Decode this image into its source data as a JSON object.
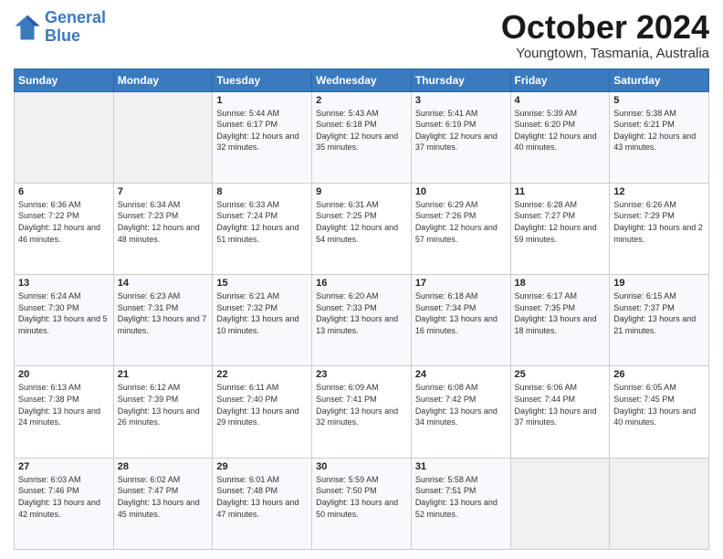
{
  "header": {
    "logo_line1": "General",
    "logo_line2": "Blue",
    "month": "October 2024",
    "location": "Youngtown, Tasmania, Australia"
  },
  "days_of_week": [
    "Sunday",
    "Monday",
    "Tuesday",
    "Wednesday",
    "Thursday",
    "Friday",
    "Saturday"
  ],
  "weeks": [
    [
      {
        "day": "",
        "info": ""
      },
      {
        "day": "",
        "info": ""
      },
      {
        "day": "1",
        "info": "Sunrise: 5:44 AM\nSunset: 6:17 PM\nDaylight: 12 hours and 32 minutes."
      },
      {
        "day": "2",
        "info": "Sunrise: 5:43 AM\nSunset: 6:18 PM\nDaylight: 12 hours and 35 minutes."
      },
      {
        "day": "3",
        "info": "Sunrise: 5:41 AM\nSunset: 6:19 PM\nDaylight: 12 hours and 37 minutes."
      },
      {
        "day": "4",
        "info": "Sunrise: 5:39 AM\nSunset: 6:20 PM\nDaylight: 12 hours and 40 minutes."
      },
      {
        "day": "5",
        "info": "Sunrise: 5:38 AM\nSunset: 6:21 PM\nDaylight: 12 hours and 43 minutes."
      }
    ],
    [
      {
        "day": "6",
        "info": "Sunrise: 6:36 AM\nSunset: 7:22 PM\nDaylight: 12 hours and 46 minutes."
      },
      {
        "day": "7",
        "info": "Sunrise: 6:34 AM\nSunset: 7:23 PM\nDaylight: 12 hours and 48 minutes."
      },
      {
        "day": "8",
        "info": "Sunrise: 6:33 AM\nSunset: 7:24 PM\nDaylight: 12 hours and 51 minutes."
      },
      {
        "day": "9",
        "info": "Sunrise: 6:31 AM\nSunset: 7:25 PM\nDaylight: 12 hours and 54 minutes."
      },
      {
        "day": "10",
        "info": "Sunrise: 6:29 AM\nSunset: 7:26 PM\nDaylight: 12 hours and 57 minutes."
      },
      {
        "day": "11",
        "info": "Sunrise: 6:28 AM\nSunset: 7:27 PM\nDaylight: 12 hours and 59 minutes."
      },
      {
        "day": "12",
        "info": "Sunrise: 6:26 AM\nSunset: 7:29 PM\nDaylight: 13 hours and 2 minutes."
      }
    ],
    [
      {
        "day": "13",
        "info": "Sunrise: 6:24 AM\nSunset: 7:30 PM\nDaylight: 13 hours and 5 minutes."
      },
      {
        "day": "14",
        "info": "Sunrise: 6:23 AM\nSunset: 7:31 PM\nDaylight: 13 hours and 7 minutes."
      },
      {
        "day": "15",
        "info": "Sunrise: 6:21 AM\nSunset: 7:32 PM\nDaylight: 13 hours and 10 minutes."
      },
      {
        "day": "16",
        "info": "Sunrise: 6:20 AM\nSunset: 7:33 PM\nDaylight: 13 hours and 13 minutes."
      },
      {
        "day": "17",
        "info": "Sunrise: 6:18 AM\nSunset: 7:34 PM\nDaylight: 13 hours and 16 minutes."
      },
      {
        "day": "18",
        "info": "Sunrise: 6:17 AM\nSunset: 7:35 PM\nDaylight: 13 hours and 18 minutes."
      },
      {
        "day": "19",
        "info": "Sunrise: 6:15 AM\nSunset: 7:37 PM\nDaylight: 13 hours and 21 minutes."
      }
    ],
    [
      {
        "day": "20",
        "info": "Sunrise: 6:13 AM\nSunset: 7:38 PM\nDaylight: 13 hours and 24 minutes."
      },
      {
        "day": "21",
        "info": "Sunrise: 6:12 AM\nSunset: 7:39 PM\nDaylight: 13 hours and 26 minutes."
      },
      {
        "day": "22",
        "info": "Sunrise: 6:11 AM\nSunset: 7:40 PM\nDaylight: 13 hours and 29 minutes."
      },
      {
        "day": "23",
        "info": "Sunrise: 6:09 AM\nSunset: 7:41 PM\nDaylight: 13 hours and 32 minutes."
      },
      {
        "day": "24",
        "info": "Sunrise: 6:08 AM\nSunset: 7:42 PM\nDaylight: 13 hours and 34 minutes."
      },
      {
        "day": "25",
        "info": "Sunrise: 6:06 AM\nSunset: 7:44 PM\nDaylight: 13 hours and 37 minutes."
      },
      {
        "day": "26",
        "info": "Sunrise: 6:05 AM\nSunset: 7:45 PM\nDaylight: 13 hours and 40 minutes."
      }
    ],
    [
      {
        "day": "27",
        "info": "Sunrise: 6:03 AM\nSunset: 7:46 PM\nDaylight: 13 hours and 42 minutes."
      },
      {
        "day": "28",
        "info": "Sunrise: 6:02 AM\nSunset: 7:47 PM\nDaylight: 13 hours and 45 minutes."
      },
      {
        "day": "29",
        "info": "Sunrise: 6:01 AM\nSunset: 7:48 PM\nDaylight: 13 hours and 47 minutes."
      },
      {
        "day": "30",
        "info": "Sunrise: 5:59 AM\nSunset: 7:50 PM\nDaylight: 13 hours and 50 minutes."
      },
      {
        "day": "31",
        "info": "Sunrise: 5:58 AM\nSunset: 7:51 PM\nDaylight: 13 hours and 52 minutes."
      },
      {
        "day": "",
        "info": ""
      },
      {
        "day": "",
        "info": ""
      }
    ]
  ]
}
